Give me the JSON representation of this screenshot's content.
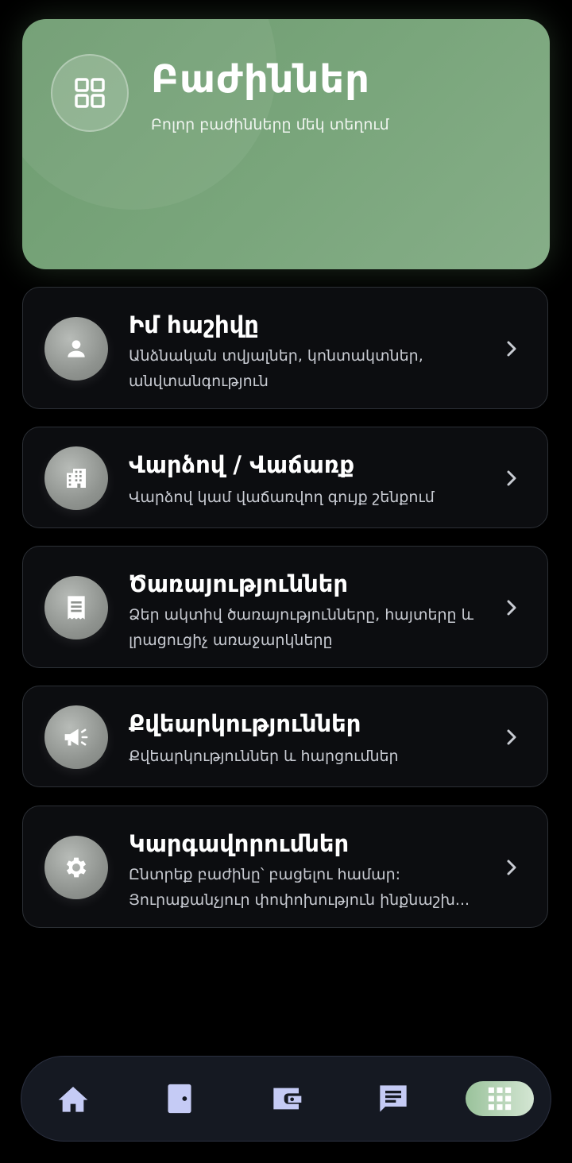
{
  "header": {
    "title": "Բաժիններ",
    "subtitle": "Բոլոր բաժինները մեկ տեղում",
    "icon": "grid-icon",
    "accent": "#7aa67c"
  },
  "sections": [
    {
      "title": "Իմ հաշիվը",
      "description": "Անձնական տվյալներ, կոնտակտներ, անվտանգություն",
      "icon": "person-icon"
    },
    {
      "title": "Վարձով / Վաճառք",
      "description": "Վարձով կամ վաճառվող գույք շենքում",
      "icon": "building-icon"
    },
    {
      "title": "Ծառայություններ",
      "description": "Ձեր ակտիվ ծառայությունները, հայտերը և լրացուցիչ առաջարկները",
      "icon": "receipt-icon"
    },
    {
      "title": "Քվեարկություններ",
      "description": "Քվեարկություններ և հարցումներ",
      "icon": "megaphone-icon"
    },
    {
      "title": "Կարգավորումներ",
      "description": "Ընտրեք բաժինը՝ բացելու համար: Յուրաքանչյուր փոփոխություն ինքնաշխ...",
      "icon": "gear-icon"
    }
  ],
  "bottom_nav": {
    "items": [
      "home-icon",
      "door-icon",
      "wallet-icon",
      "chat-icon",
      "apps-icon"
    ],
    "active_index": 4,
    "icon_color": "#c5cbf5"
  }
}
